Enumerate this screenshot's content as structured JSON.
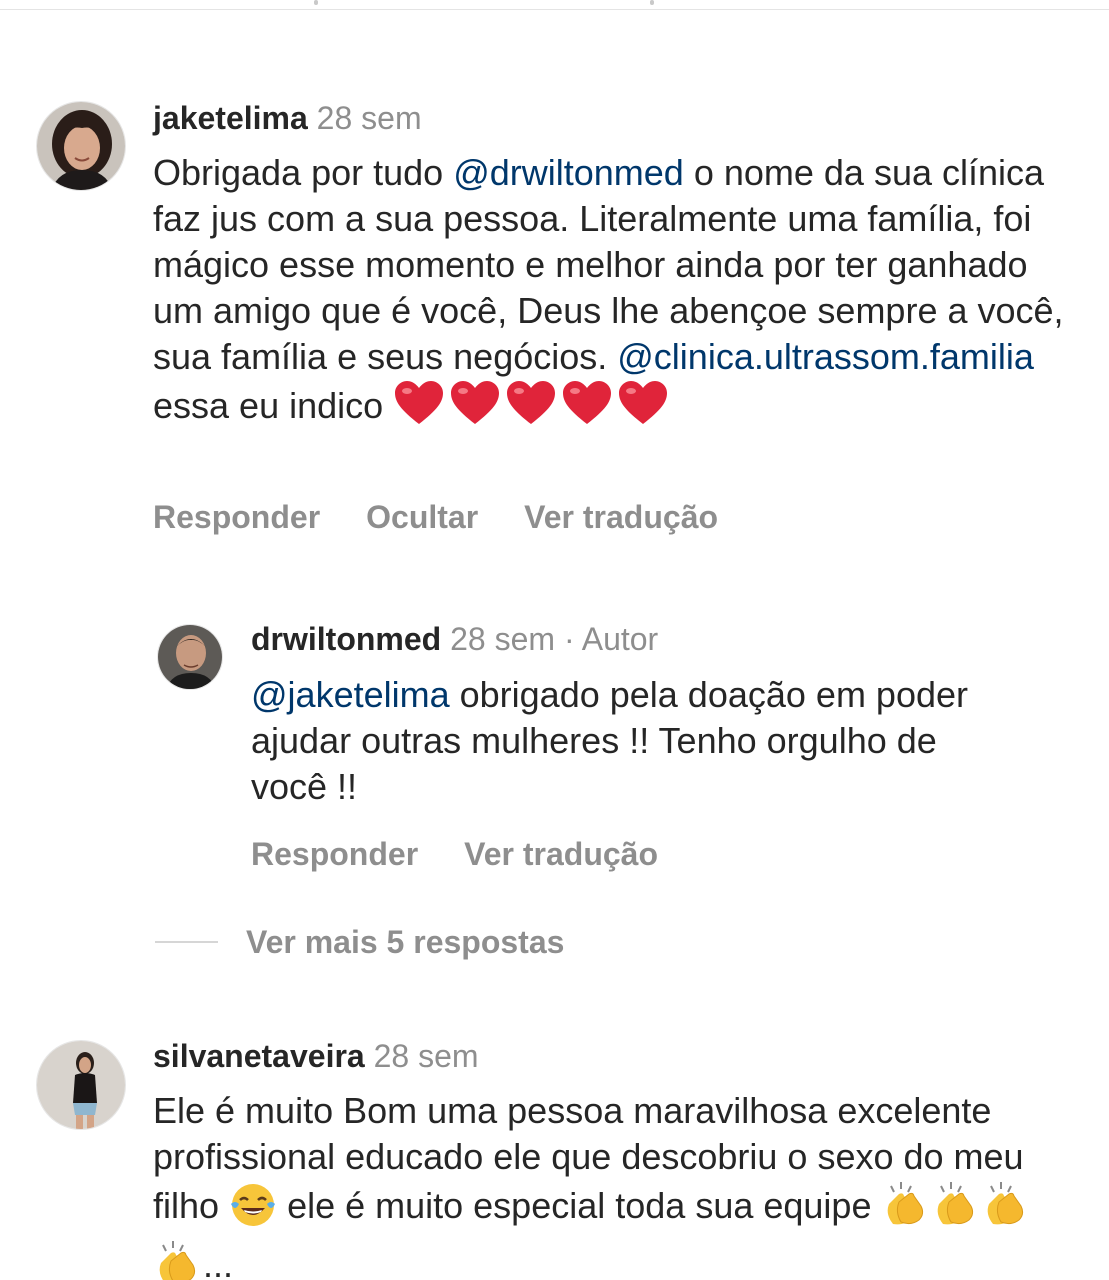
{
  "comments": [
    {
      "username": "jaketelima",
      "time": "28 sem",
      "text_parts": [
        "Obrigada por tudo ",
        "@drwiltonmed",
        " o nome da sua clínica faz jus com a sua pessoa. Literalmente uma família, foi mágico esse momento e melhor ainda por ter ganhado um amigo que é você, Deus lhe abençoe sempre a você, sua família e seus negócios. ",
        "@clinica.ultrassom.familia",
        " essa eu indico"
      ],
      "reply_label": "Responder",
      "hide_label": "Ocultar",
      "translate_label": "Ver tradução"
    },
    {
      "username": "drwiltonmed",
      "time": "28 sem",
      "author_label": "· Autor",
      "text_parts": [
        "@jaketelima",
        " obrigado pela doação em poder ajudar outras mulheres !! Tenho orgulho de você !!"
      ],
      "reply_label": "Responder",
      "translate_label": "Ver tradução"
    },
    {
      "username": "silvanetaveira",
      "time": "28 sem",
      "text_parts": [
        "Ele é muito  Bom  uma pessoa maravilhosa excelente profissional  educado  ele que descobriu o sexo do meu filho",
        " ele é muito especial  toda sua equipe",
        "..."
      ]
    }
  ],
  "view_more_replies": "Ver mais 5 respostas",
  "colors": {
    "mention": "#00376b",
    "meta": "#8e8e8e",
    "text": "#262626",
    "heart": "#e0243a"
  },
  "icons": [
    "heart-emoji",
    "laughing-tears-emoji",
    "clapping-hands-emoji"
  ]
}
